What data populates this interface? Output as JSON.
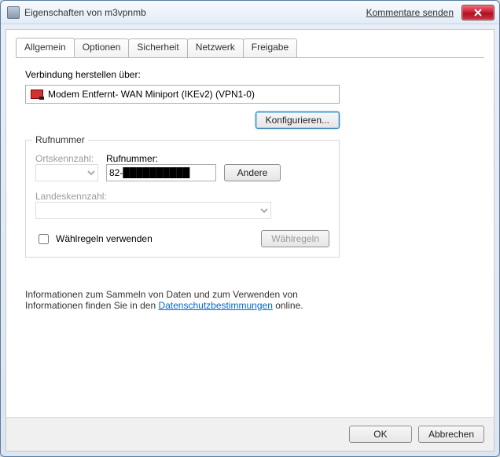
{
  "title": "Eigenschaften von m3vpnmb",
  "comments_link": "Kommentare senden",
  "tabs": {
    "allgemein": "Allgemein",
    "optionen": "Optionen",
    "sicherheit": "Sicherheit",
    "netzwerk": "Netzwerk",
    "freigabe": "Freigabe"
  },
  "connect_via_label": "Verbindung herstellen über:",
  "connect_via_value": "Modem Entfernt- WAN Miniport (IKEv2) (VPN1-0)",
  "configure_btn": "Konfigurieren...",
  "rufnummer_group": "Rufnummer",
  "ortskennzahl_label": "Ortskennzahl:",
  "rufnummer_label": "Rufnummer:",
  "rufnummer_value": "82-██████████",
  "andere_btn": "Andere",
  "landeskennzahl_label": "Landeskennzahl:",
  "waehlregeln_chk": "Wählregeln verwenden",
  "waehlregeln_btn": "Wählregeln",
  "info_text_1": "Informationen zum Sammeln von Daten und zum Verwenden von Informationen finden Sie in den ",
  "info_link": "Datenschutzbestimmungen",
  "info_text_2": " online.",
  "ok_btn": "OK",
  "cancel_btn": "Abbrechen"
}
